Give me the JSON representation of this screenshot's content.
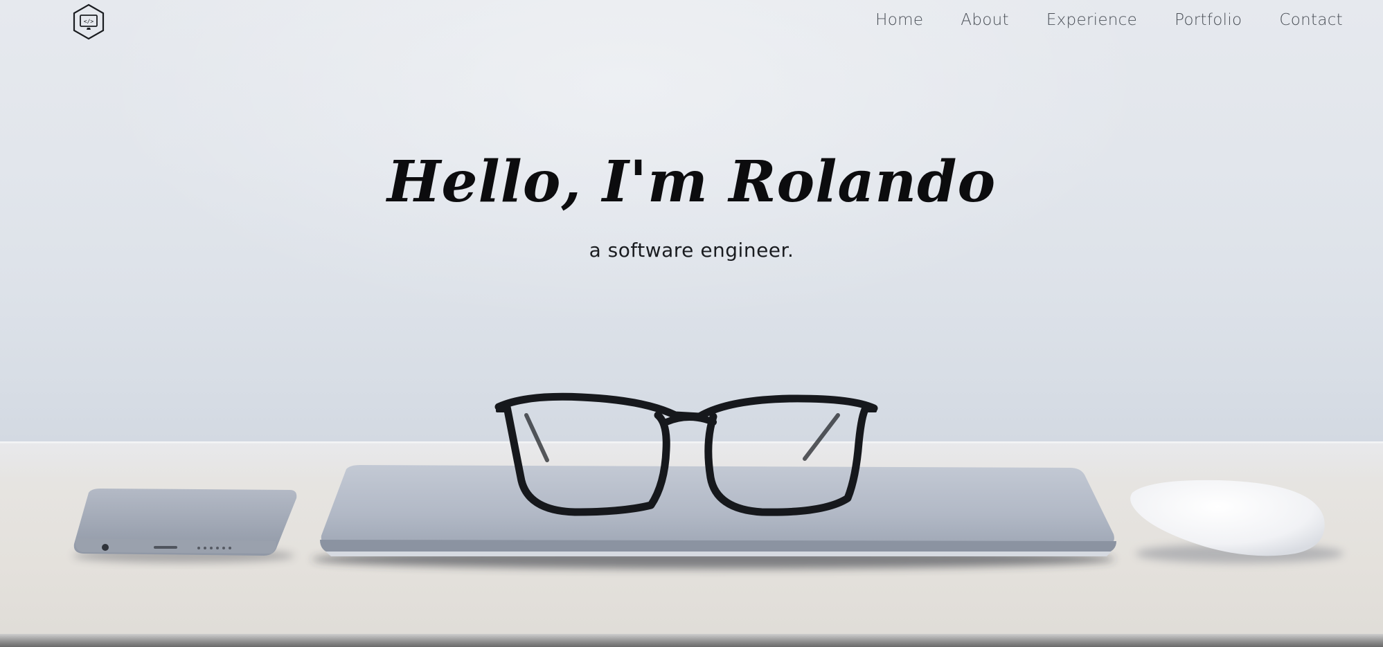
{
  "nav": {
    "logo_icon": "code-monitor-icon",
    "items": [
      {
        "label": "Home"
      },
      {
        "label": "About"
      },
      {
        "label": "Experience"
      },
      {
        "label": "Portfolio"
      },
      {
        "label": "Contact"
      }
    ]
  },
  "hero": {
    "title": "Hello, I'm Rolando",
    "subtitle": "a software engineer."
  },
  "colors": {
    "text_dark": "#0c0c0e",
    "nav_text": "#4a4f57",
    "wall": "#dde2e9",
    "desk": "#e4e1dc"
  }
}
